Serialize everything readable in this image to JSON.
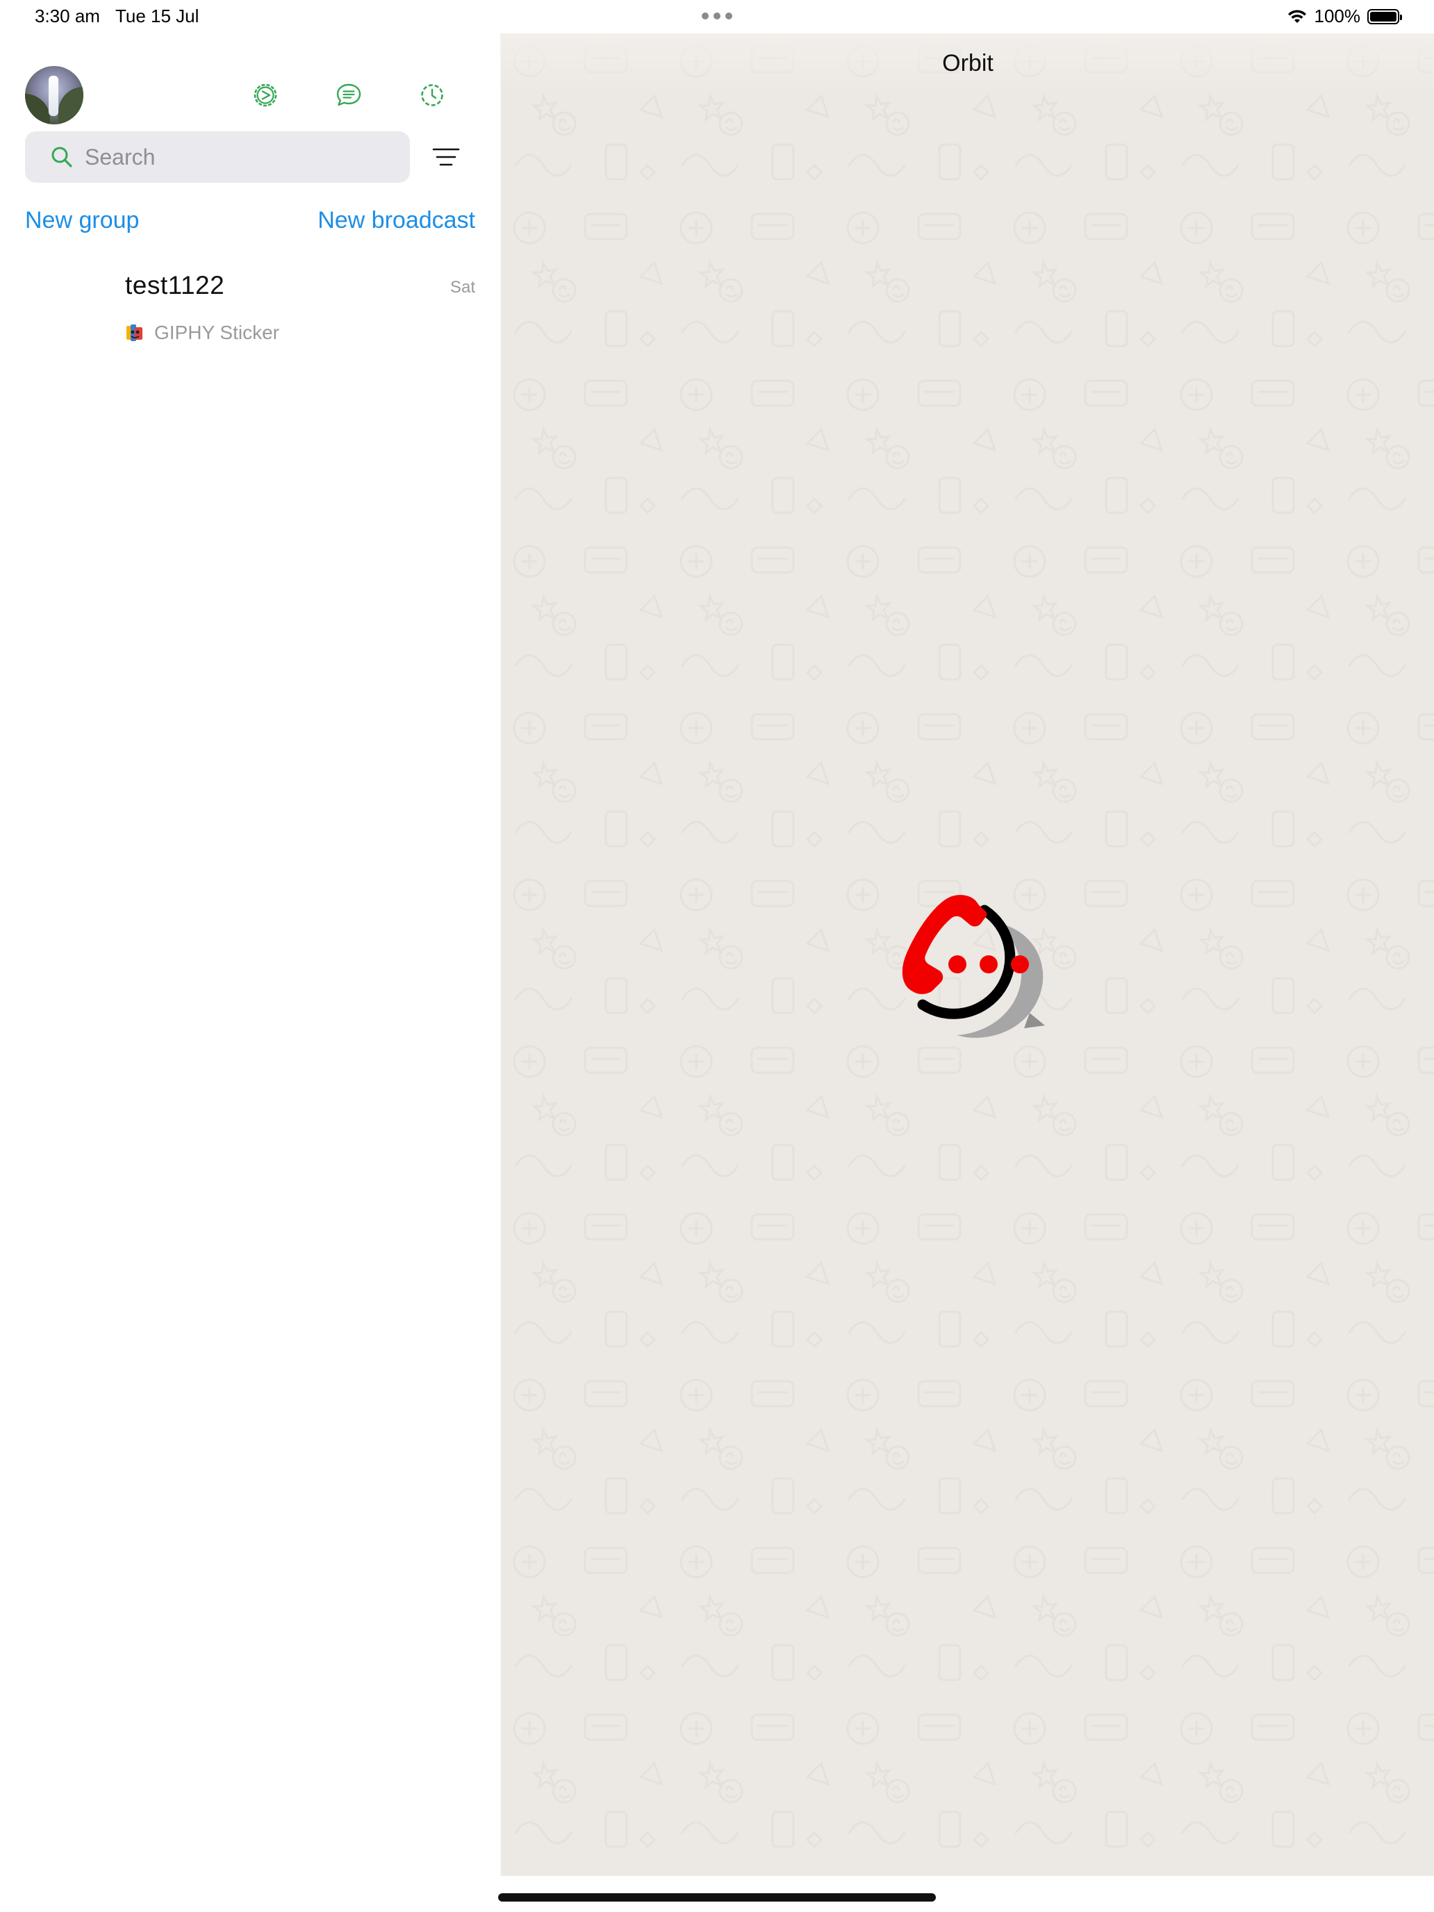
{
  "status_bar": {
    "time": "3:30 am",
    "date": "Tue 15 Jul",
    "battery": "100%",
    "icons": [
      "wifi-icon",
      "battery-icon"
    ]
  },
  "sidebar": {
    "top_icons": [
      "settings-icon",
      "chats-icon",
      "status-icon"
    ],
    "search_placeholder": "Search",
    "new_group": "New group",
    "new_broadcast": "New broadcast",
    "chats": [
      {
        "name": "test1122",
        "time": "Sat",
        "preview": "GIPHY Sticker"
      }
    ]
  },
  "detail": {
    "title": "Orbit"
  },
  "colors": {
    "accent_green": "#34a853",
    "link_blue": "#1b8ee6",
    "logo_red": "#f20000",
    "background": "#ece8e3"
  }
}
